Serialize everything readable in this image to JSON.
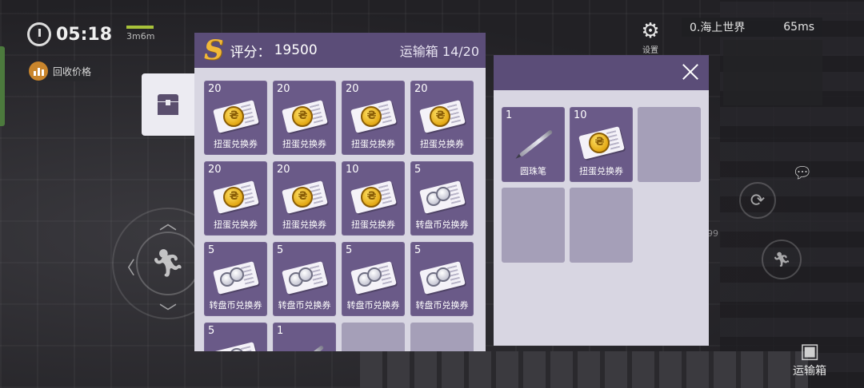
{
  "hud": {
    "timer": "05:18",
    "mini_stat": "3m6m",
    "recycle_label": "回收价格",
    "settings_label": "设置",
    "server_name": "0.海上世界",
    "ping": "65ms",
    "crate_button_label": "运输箱",
    "background_number": "99"
  },
  "left_panel": {
    "rank": "S",
    "score_label": "评分：",
    "score_value": "19500",
    "crate_label": "运输箱",
    "crate_count": "14/20",
    "slots": [
      {
        "qty": "20",
        "name": "扭蛋兑换券",
        "icon": "gacha-ticket-icon"
      },
      {
        "qty": "20",
        "name": "扭蛋兑换券",
        "icon": "gacha-ticket-icon"
      },
      {
        "qty": "20",
        "name": "扭蛋兑换券",
        "icon": "gacha-ticket-icon"
      },
      {
        "qty": "20",
        "name": "扭蛋兑换券",
        "icon": "gacha-ticket-icon"
      },
      {
        "qty": "20",
        "name": "扭蛋兑换券",
        "icon": "gacha-ticket-icon"
      },
      {
        "qty": "20",
        "name": "扭蛋兑换券",
        "icon": "gacha-ticket-icon"
      },
      {
        "qty": "10",
        "name": "扭蛋兑换券",
        "icon": "gacha-ticket-icon"
      },
      {
        "qty": "5",
        "name": "转盘币兑换券",
        "icon": "wheel-coin-ticket-icon"
      },
      {
        "qty": "5",
        "name": "转盘币兑换券",
        "icon": "wheel-coin-ticket-icon"
      },
      {
        "qty": "5",
        "name": "转盘币兑换券",
        "icon": "wheel-coin-ticket-icon"
      },
      {
        "qty": "5",
        "name": "转盘币兑换券",
        "icon": "wheel-coin-ticket-icon"
      },
      {
        "qty": "5",
        "name": "转盘币兑换券",
        "icon": "wheel-coin-ticket-icon"
      },
      {
        "qty": "5",
        "name": "",
        "icon": "wheel-coin-ticket-icon"
      },
      {
        "qty": "1",
        "name": "",
        "icon": "ballpoint-pen-icon"
      },
      {
        "qty": "",
        "name": "",
        "icon": ""
      },
      {
        "qty": "",
        "name": "",
        "icon": ""
      }
    ]
  },
  "right_panel": {
    "slots": [
      {
        "qty": "1",
        "name": "圆珠笔",
        "icon": "ballpoint-pen-icon"
      },
      {
        "qty": "10",
        "name": "扭蛋兑换券",
        "icon": "gacha-ticket-icon"
      },
      {
        "qty": "",
        "name": "",
        "icon": ""
      },
      {
        "qty": "",
        "name": "",
        "icon": ""
      },
      {
        "qty": "",
        "name": "",
        "icon": ""
      }
    ]
  },
  "colors": {
    "panel_header": "#5b4d78",
    "slot_bg": "#6a5a88",
    "empty_slot": "#a59fb8",
    "panel_bg": "#d8d6e2",
    "rank_gold": "#f1b838"
  }
}
